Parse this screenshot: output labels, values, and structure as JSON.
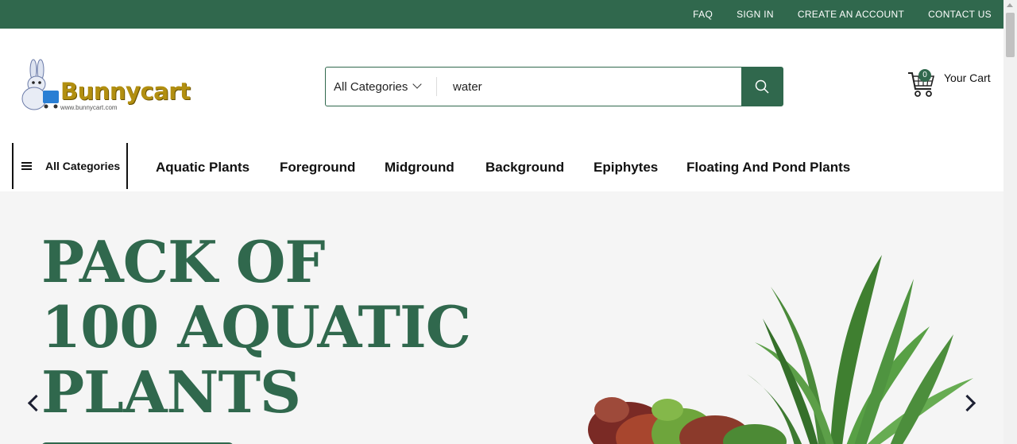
{
  "topbar": {
    "links": [
      "FAQ",
      "SIGN IN",
      "CREATE AN ACCOUNT",
      "CONTACT US"
    ]
  },
  "header": {
    "logo_text": "Bunnycart",
    "logo_sub": "www.bunnycart.com",
    "search": {
      "category": "All Categories",
      "value": "water"
    },
    "cart": {
      "count": "0",
      "label": "Your Cart"
    }
  },
  "nav": {
    "all_categories": "All Categories",
    "items": [
      "Aquatic Plants",
      "Foreground",
      "Midground",
      "Background",
      "Epiphytes",
      "Floating And Pond Plants"
    ]
  },
  "hero": {
    "title_lines": [
      "PACK OF",
      "100 AQUATIC",
      "PLANTS"
    ]
  },
  "colors": {
    "brand_green": "#30684d",
    "logo_gold": "#b28f10"
  },
  "icons": [
    "search-icon",
    "cart-icon",
    "hamburger-icon",
    "chevron-down-icon",
    "arrow-left-icon",
    "arrow-right-icon"
  ]
}
